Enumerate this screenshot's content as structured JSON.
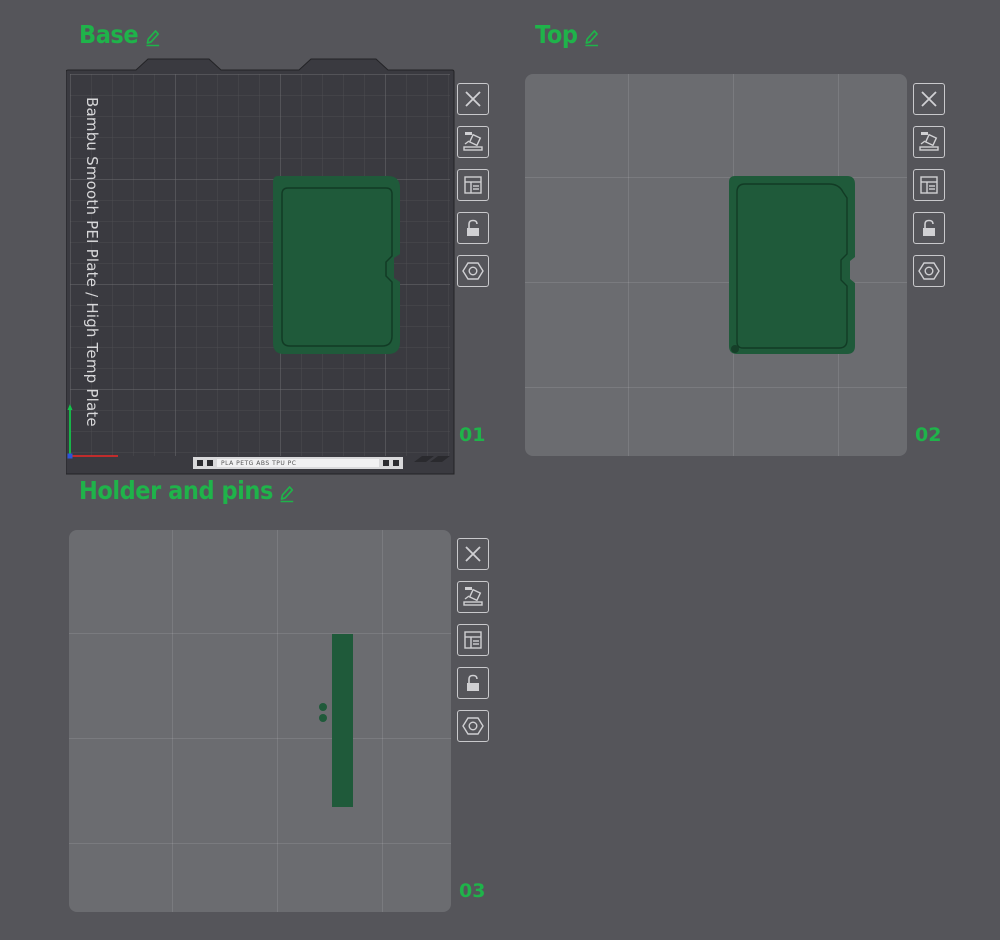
{
  "plates": [
    {
      "name": "Base",
      "index": "01",
      "bed_label": "Bambu Smooth PEI Plate / High Temp Plate",
      "filament_strip": "PLA PETG ABS TPU PC"
    },
    {
      "name": "Top",
      "index": "02"
    },
    {
      "name": "Holder and pins",
      "index": "03"
    }
  ],
  "icons": {
    "edit": "pencil-icon",
    "tools": [
      "close-icon",
      "auto-orient-icon",
      "arrange-icon",
      "lock-icon",
      "settings-hex-icon"
    ]
  },
  "colors": {
    "background": "#55555a",
    "plate": "#6b6c70",
    "textured_plate": "#3b3b41",
    "accent_green": "#1fb34a",
    "model_green": "#1f5a3a"
  }
}
